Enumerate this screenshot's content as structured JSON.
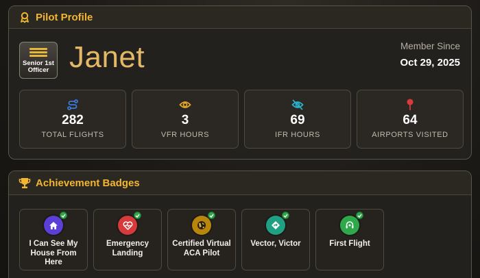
{
  "profile": {
    "title": "Pilot Profile",
    "rank": "Senior 1st Officer",
    "name": "Janet",
    "member_since_label": "Member Since",
    "member_since_date": "Oct 29, 2025"
  },
  "stats": [
    {
      "value": "282",
      "label": "TOTAL FLIGHTS",
      "icon": "route-icon",
      "color": "#3b7be0"
    },
    {
      "value": "3",
      "label": "VFR HOURS",
      "icon": "eye-icon",
      "color": "#e8a72a"
    },
    {
      "value": "69",
      "label": "IFR HOURS",
      "icon": "eye-slash-icon",
      "color": "#27b3cf"
    },
    {
      "value": "64",
      "label": "AIRPORTS VISITED",
      "icon": "map-pin-icon",
      "color": "#d93a3a"
    }
  ],
  "badges": {
    "title": "Achievement Badges",
    "items": [
      {
        "name": "I Can See My House From Here",
        "icon": "house-icon",
        "color": "#5b3fd6"
      },
      {
        "name": "Emergency Landing",
        "icon": "heart-pulse-icon",
        "color": "#d73a3a"
      },
      {
        "name": "Certified Virtual ACA Pilot",
        "icon": "globe-icon",
        "color": "#b8860b"
      },
      {
        "name": "Vector, Victor",
        "icon": "diamond-arrow-icon",
        "color": "#1fa083"
      },
      {
        "name": "First Flight",
        "icon": "headset-icon",
        "color": "#2ea84a"
      }
    ]
  }
}
